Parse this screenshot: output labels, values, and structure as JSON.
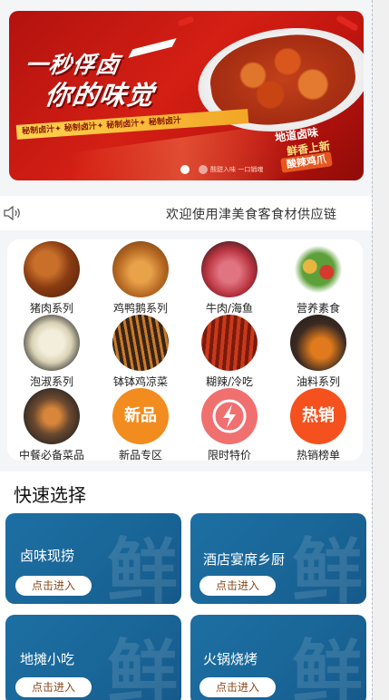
{
  "banner": {
    "title_line1": "一秒俘卤",
    "title_line2": "你的味觉",
    "tagline": "秘制卤汁✦ 秘制卤汁✦ 秘制卤汁✦ 秘制卤汁",
    "side_text1": "地道卤味",
    "side_text2": "鲜香上新",
    "side_badge": "酸辣鸡爪",
    "small_note": "酸甜入味 一口销魂",
    "slide_count": 2,
    "active_slide": 1
  },
  "notice": {
    "icon": "speaker-icon",
    "text": "欢迎使用津美食客食材供应链"
  },
  "categories": [
    {
      "label": "猪肉系列",
      "icon": "pork-photo"
    },
    {
      "label": "鸡鸭鹅系列",
      "icon": "poultry-photo"
    },
    {
      "label": "牛肉/海鱼",
      "icon": "beef-photo"
    },
    {
      "label": "营养素食",
      "icon": "vegetables-photo"
    },
    {
      "label": "泡淑系列",
      "icon": "pickle-photo"
    },
    {
      "label": "钵钵鸡凉菜",
      "icon": "skewer-photo"
    },
    {
      "label": "糊辣/冷吃",
      "icon": "spicy-photo"
    },
    {
      "label": "油料系列",
      "icon": "oil-photo"
    },
    {
      "label": "中餐必备菜品",
      "icon": "dish-photo"
    },
    {
      "label": "新品专区",
      "icon": "new-badge-icon",
      "badge": "新品",
      "color": "#f28c1e"
    },
    {
      "label": "限时特价",
      "icon": "lightning-icon",
      "color": "#f07070"
    },
    {
      "label": "热销榜单",
      "icon": "hot-badge-icon",
      "badge": "热销",
      "color": "#f4511e"
    }
  ],
  "quick": {
    "title": "快速选择",
    "bg_char": "鲜",
    "cards": [
      {
        "title": "卤味现捞",
        "button": "点击进入"
      },
      {
        "title": "酒店宴席乡厨",
        "button": "点击进入"
      },
      {
        "title": "地摊小吃",
        "button": "点击进入"
      },
      {
        "title": "火锅烧烤",
        "button": "点击进入"
      }
    ]
  },
  "colors": {
    "card_blue": "#1a6799",
    "banner_red": "#c8160f",
    "button_text": "#8a4a1d"
  }
}
